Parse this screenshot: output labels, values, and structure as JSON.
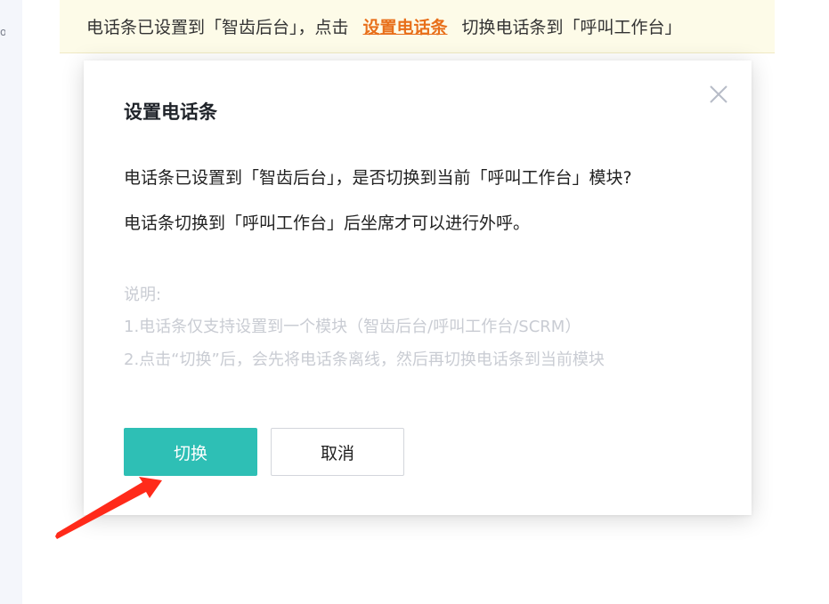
{
  "notice": {
    "text_before": "电话条已设置到「智齿后台」，点击",
    "link": "设置电话条",
    "text_after": "切换电话条到「呼叫工作台」"
  },
  "dialog": {
    "title": "设置电话条",
    "message_1": "电话条已设置到「智齿后台」，是否切换到当前「呼叫工作台」模块?",
    "message_2": "电话条切换到「呼叫工作台」后坐席才可以进行外呼。",
    "note_title": "说明:",
    "note_1": "1.电话条仅支持设置到一个模块（智齿后台/呼叫工作台/SCRM）",
    "note_2": "2.点击“切换”后，会先将电话条离线，然后再切换电话条到当前模块",
    "confirm_label": "切换",
    "cancel_label": "取消"
  },
  "sidebar": {
    "partial_glyph": "o"
  },
  "colors": {
    "primary": "#2ebfb5",
    "link": "#e86f1a",
    "notice_bg": "#fdfbe8",
    "annotation_arrow": "#ff2a1a"
  },
  "icons": {
    "close": "close-icon",
    "annotation": "red-arrow-icon"
  }
}
